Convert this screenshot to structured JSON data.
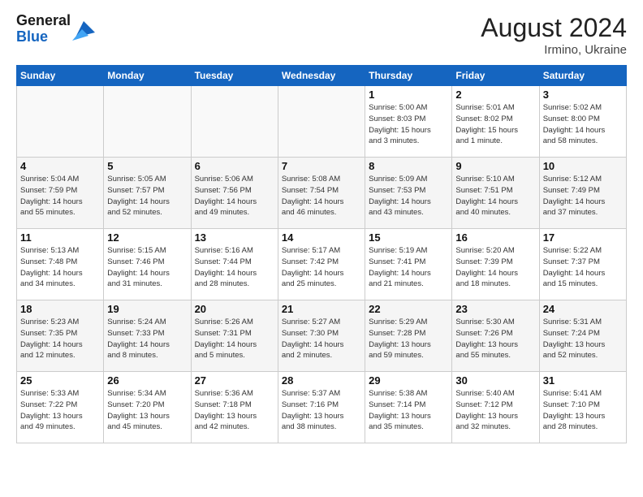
{
  "header": {
    "logo_general": "General",
    "logo_blue": "Blue",
    "month_title": "August 2024",
    "location": "Irmino, Ukraine"
  },
  "days_of_week": [
    "Sunday",
    "Monday",
    "Tuesday",
    "Wednesday",
    "Thursday",
    "Friday",
    "Saturday"
  ],
  "weeks": [
    [
      {
        "day": "",
        "info": ""
      },
      {
        "day": "",
        "info": ""
      },
      {
        "day": "",
        "info": ""
      },
      {
        "day": "",
        "info": ""
      },
      {
        "day": "1",
        "info": "Sunrise: 5:00 AM\nSunset: 8:03 PM\nDaylight: 15 hours\nand 3 minutes."
      },
      {
        "day": "2",
        "info": "Sunrise: 5:01 AM\nSunset: 8:02 PM\nDaylight: 15 hours\nand 1 minute."
      },
      {
        "day": "3",
        "info": "Sunrise: 5:02 AM\nSunset: 8:00 PM\nDaylight: 14 hours\nand 58 minutes."
      }
    ],
    [
      {
        "day": "4",
        "info": "Sunrise: 5:04 AM\nSunset: 7:59 PM\nDaylight: 14 hours\nand 55 minutes."
      },
      {
        "day": "5",
        "info": "Sunrise: 5:05 AM\nSunset: 7:57 PM\nDaylight: 14 hours\nand 52 minutes."
      },
      {
        "day": "6",
        "info": "Sunrise: 5:06 AM\nSunset: 7:56 PM\nDaylight: 14 hours\nand 49 minutes."
      },
      {
        "day": "7",
        "info": "Sunrise: 5:08 AM\nSunset: 7:54 PM\nDaylight: 14 hours\nand 46 minutes."
      },
      {
        "day": "8",
        "info": "Sunrise: 5:09 AM\nSunset: 7:53 PM\nDaylight: 14 hours\nand 43 minutes."
      },
      {
        "day": "9",
        "info": "Sunrise: 5:10 AM\nSunset: 7:51 PM\nDaylight: 14 hours\nand 40 minutes."
      },
      {
        "day": "10",
        "info": "Sunrise: 5:12 AM\nSunset: 7:49 PM\nDaylight: 14 hours\nand 37 minutes."
      }
    ],
    [
      {
        "day": "11",
        "info": "Sunrise: 5:13 AM\nSunset: 7:48 PM\nDaylight: 14 hours\nand 34 minutes."
      },
      {
        "day": "12",
        "info": "Sunrise: 5:15 AM\nSunset: 7:46 PM\nDaylight: 14 hours\nand 31 minutes."
      },
      {
        "day": "13",
        "info": "Sunrise: 5:16 AM\nSunset: 7:44 PM\nDaylight: 14 hours\nand 28 minutes."
      },
      {
        "day": "14",
        "info": "Sunrise: 5:17 AM\nSunset: 7:42 PM\nDaylight: 14 hours\nand 25 minutes."
      },
      {
        "day": "15",
        "info": "Sunrise: 5:19 AM\nSunset: 7:41 PM\nDaylight: 14 hours\nand 21 minutes."
      },
      {
        "day": "16",
        "info": "Sunrise: 5:20 AM\nSunset: 7:39 PM\nDaylight: 14 hours\nand 18 minutes."
      },
      {
        "day": "17",
        "info": "Sunrise: 5:22 AM\nSunset: 7:37 PM\nDaylight: 14 hours\nand 15 minutes."
      }
    ],
    [
      {
        "day": "18",
        "info": "Sunrise: 5:23 AM\nSunset: 7:35 PM\nDaylight: 14 hours\nand 12 minutes."
      },
      {
        "day": "19",
        "info": "Sunrise: 5:24 AM\nSunset: 7:33 PM\nDaylight: 14 hours\nand 8 minutes."
      },
      {
        "day": "20",
        "info": "Sunrise: 5:26 AM\nSunset: 7:31 PM\nDaylight: 14 hours\nand 5 minutes."
      },
      {
        "day": "21",
        "info": "Sunrise: 5:27 AM\nSunset: 7:30 PM\nDaylight: 14 hours\nand 2 minutes."
      },
      {
        "day": "22",
        "info": "Sunrise: 5:29 AM\nSunset: 7:28 PM\nDaylight: 13 hours\nand 59 minutes."
      },
      {
        "day": "23",
        "info": "Sunrise: 5:30 AM\nSunset: 7:26 PM\nDaylight: 13 hours\nand 55 minutes."
      },
      {
        "day": "24",
        "info": "Sunrise: 5:31 AM\nSunset: 7:24 PM\nDaylight: 13 hours\nand 52 minutes."
      }
    ],
    [
      {
        "day": "25",
        "info": "Sunrise: 5:33 AM\nSunset: 7:22 PM\nDaylight: 13 hours\nand 49 minutes."
      },
      {
        "day": "26",
        "info": "Sunrise: 5:34 AM\nSunset: 7:20 PM\nDaylight: 13 hours\nand 45 minutes."
      },
      {
        "day": "27",
        "info": "Sunrise: 5:36 AM\nSunset: 7:18 PM\nDaylight: 13 hours\nand 42 minutes."
      },
      {
        "day": "28",
        "info": "Sunrise: 5:37 AM\nSunset: 7:16 PM\nDaylight: 13 hours\nand 38 minutes."
      },
      {
        "day": "29",
        "info": "Sunrise: 5:38 AM\nSunset: 7:14 PM\nDaylight: 13 hours\nand 35 minutes."
      },
      {
        "day": "30",
        "info": "Sunrise: 5:40 AM\nSunset: 7:12 PM\nDaylight: 13 hours\nand 32 minutes."
      },
      {
        "day": "31",
        "info": "Sunrise: 5:41 AM\nSunset: 7:10 PM\nDaylight: 13 hours\nand 28 minutes."
      }
    ]
  ]
}
